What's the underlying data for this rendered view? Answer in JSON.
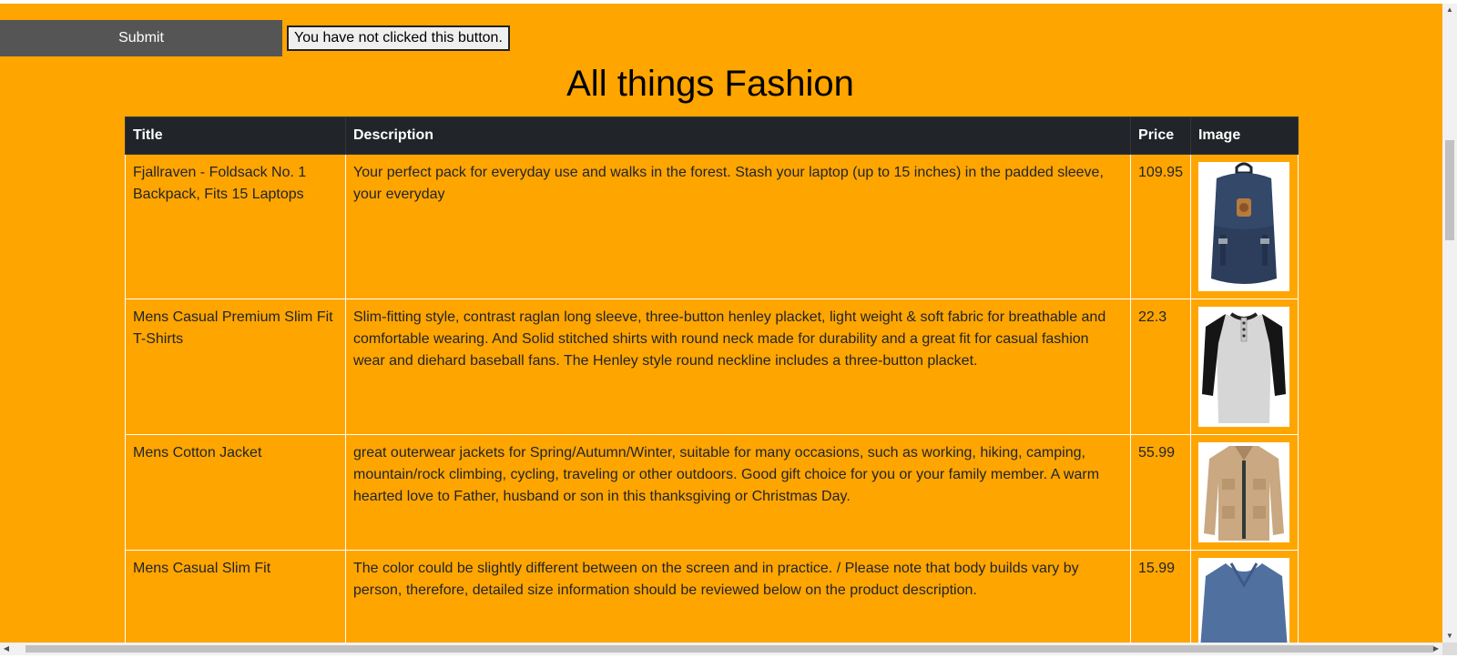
{
  "toolbar": {
    "submit_label": "Submit",
    "status_label": "You have not clicked this button."
  },
  "page": {
    "title": "All things Fashion"
  },
  "table": {
    "headers": {
      "title": "Title",
      "description": "Description",
      "price": "Price",
      "image": "Image"
    },
    "rows": [
      {
        "title": "Fjallraven - Foldsack No. 1 Backpack, Fits 15 Laptops",
        "description": "Your perfect pack for everyday use and walks in the forest. Stash your laptop (up to 15 inches) in the padded sleeve, your everyday",
        "price": "109.95",
        "image": "navy backpack"
      },
      {
        "title": "Mens Casual Premium Slim Fit T-Shirts",
        "description": "Slim-fitting style, contrast raglan long sleeve, three-button henley placket, light weight & soft fabric for breathable and comfortable wearing. And Solid stitched shirts with round neck made for durability and a great fit for casual fashion wear and diehard baseball fans. The Henley style round neckline includes a three-button placket.",
        "price": "22.3",
        "image": "raglan henley shirt"
      },
      {
        "title": "Mens Cotton Jacket",
        "description": "great outerwear jackets for Spring/Autumn/Winter, suitable for many occasions, such as working, hiking, camping, mountain/rock climbing, cycling, traveling or other outdoors. Good gift choice for you or your family member. A warm hearted love to Father, husband or son in this thanksgiving or Christmas Day.",
        "price": "55.99",
        "image": "khaki cotton jacket"
      },
      {
        "title": "Mens Casual Slim Fit",
        "description": "The color could be slightly different between on the screen and in practice. / Please note that body builds vary by person, therefore, detailed size information should be reviewed below on the product description.",
        "price": "15.99",
        "image": "blue long sleeve shirt"
      }
    ]
  },
  "colors": {
    "page_background": "#FFA500",
    "header_background": "#212529",
    "submit_background": "#555555"
  }
}
